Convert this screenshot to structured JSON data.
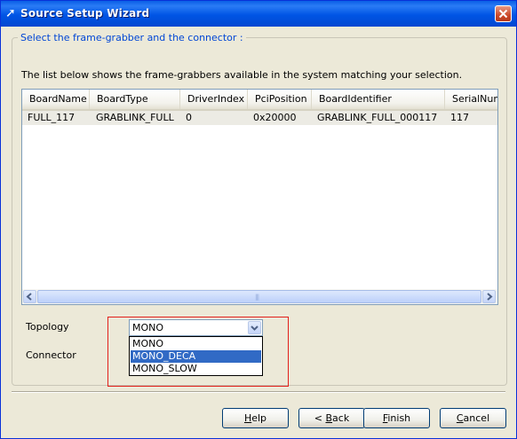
{
  "window": {
    "title": "Source Setup Wizard"
  },
  "group": {
    "title": "Select the frame-grabber and the connector :"
  },
  "description": "The list below shows the frame-grabbers available in the system matching your selection.",
  "table": {
    "columns": [
      "BoardName",
      "BoardType",
      "DriverIndex",
      "PciPosition",
      "BoardIdentifier",
      "SerialNum"
    ],
    "rows": [
      [
        "FULL_117",
        "GRABLINK_FULL",
        "0",
        "0x20000",
        "GRABLINK_FULL_000117",
        "117"
      ]
    ]
  },
  "topology": {
    "label": "Topology",
    "value": "MONO",
    "options": [
      "MONO",
      "MONO_DECA",
      "MONO_SLOW"
    ],
    "highlighted": "MONO_DECA"
  },
  "connector": {
    "label": "Connector"
  },
  "buttons": {
    "help": {
      "pre": "",
      "key": "H",
      "post": "elp"
    },
    "back": {
      "pre": "< ",
      "key": "B",
      "post": "ack"
    },
    "finish": {
      "pre": "",
      "key": "F",
      "post": "inish"
    },
    "cancel": {
      "pre": "",
      "key": "C",
      "post": "ancel"
    }
  },
  "colors": {
    "title_bar": "#0055e5",
    "group_title": "#0046d5",
    "selection": "#316ac5",
    "highlight_box": "#e2201b"
  }
}
